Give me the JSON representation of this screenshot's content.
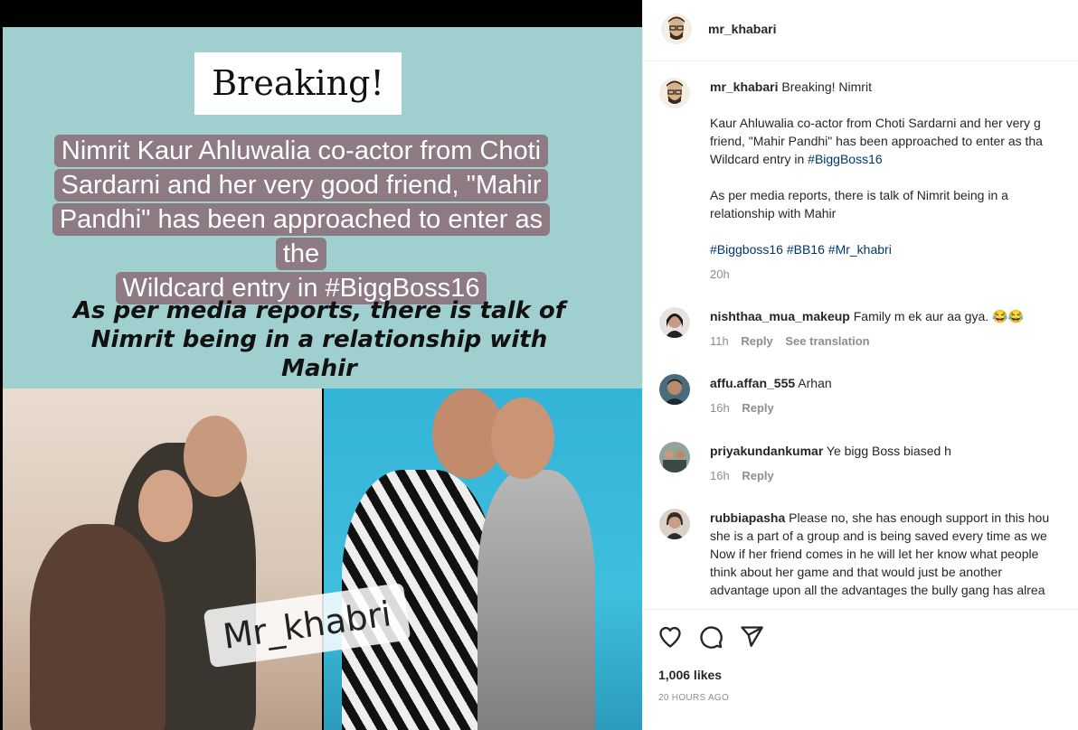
{
  "post_image": {
    "breaking": "Breaking!",
    "headline_lines": [
      "Nimrit Kaur Ahluwalia co-actor from Choti",
      "Sardarni and her very good friend, \"Mahir",
      "Pandhi\" has been approached to enter as the",
      "Wildcard entry in #BiggBoss16"
    ],
    "subline_lines": [
      "As per media reports, there is talk of",
      "Nimrit being in a relationship with",
      "Mahir"
    ],
    "watermark": "Mr_khabri"
  },
  "header": {
    "username": "mr_khabari"
  },
  "caption": {
    "username": "mr_khabari",
    "line1": "Breaking! Nimrit",
    "para1": [
      "Kaur Ahluwalia co-actor from Choti Sardarni and her very g",
      "friend, \"Mahir Pandhi\" has been approached to enter as tha",
      "Wildcard entry in "
    ],
    "para1_hashtag": "#BiggBoss16",
    "para2": [
      "As per media reports, there is talk of Nimrit being in a",
      "relationship with Mahir"
    ],
    "hashtags": [
      "#Biggboss16",
      "#BB16",
      "#Mr_khabri"
    ],
    "time": "20h"
  },
  "comments": [
    {
      "username": "nishthaa_mua_makeup",
      "lines": [
        "Family m ek aur aa gya. 😂😂"
      ],
      "time": "11h",
      "reply": "Reply",
      "translate": "See translation"
    },
    {
      "username": "affu.affan_555",
      "lines": [
        "Arhan"
      ],
      "time": "16h",
      "reply": "Reply"
    },
    {
      "username": "priyakundankumar",
      "lines": [
        "Ye bigg Boss biased h"
      ],
      "time": "16h",
      "reply": "Reply"
    },
    {
      "username": "rubbiapasha",
      "lines": [
        "Please no, she has enough support in this hou",
        "she is a part of a group and is being saved every time as we",
        "Now if her friend comes in he will let her know what people",
        "think about her game and that would just be another",
        "advantage upon all the advantages the bully gang has alrea"
      ]
    }
  ],
  "actions": {
    "likes": "1,006 likes",
    "timestamp": "20 HOURS AGO"
  },
  "colors": {
    "link": "#00376b",
    "meta": "#8e8e8e",
    "border": "#efefef"
  },
  "icons": [
    "heart-icon",
    "comment-icon",
    "share-icon"
  ]
}
